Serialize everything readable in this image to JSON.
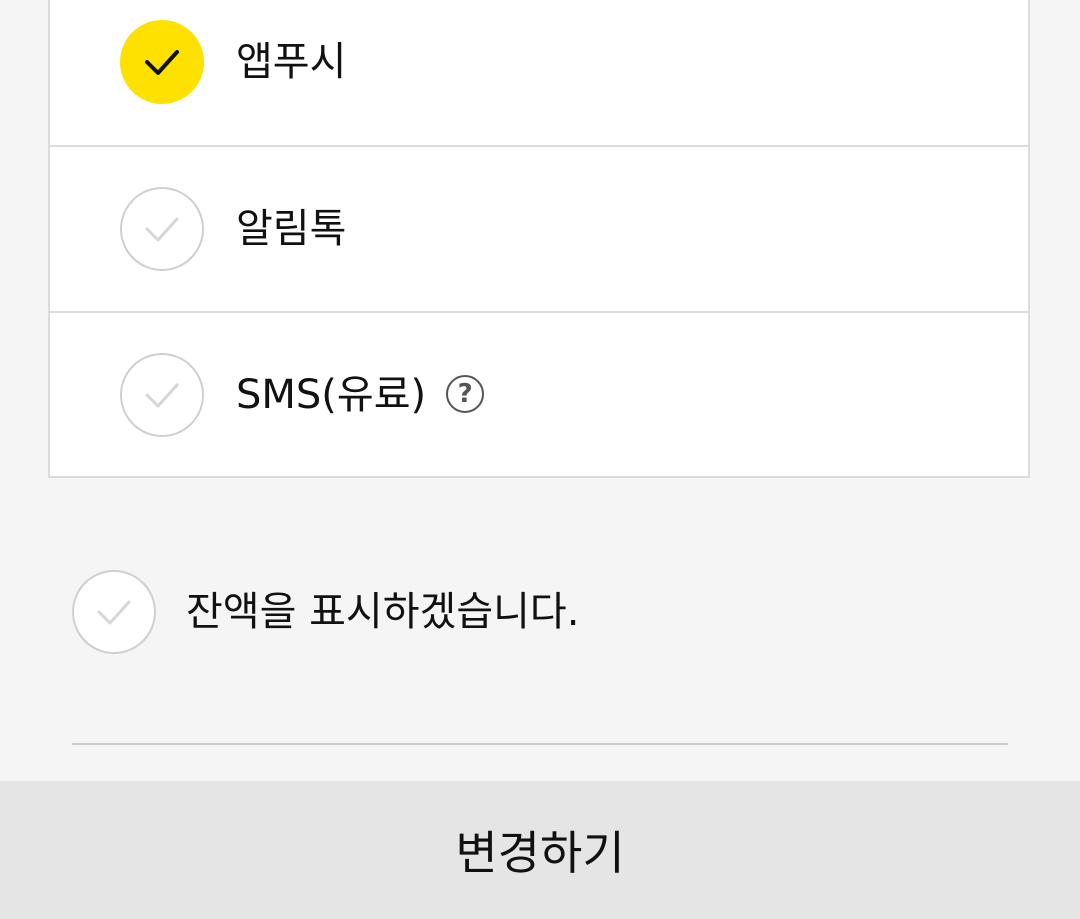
{
  "notification_options": [
    {
      "label": "앱푸시",
      "checked": true
    },
    {
      "label": "알림톡",
      "checked": false
    },
    {
      "label": "SMS(유료)",
      "checked": false,
      "help_icon": "?"
    }
  ],
  "balance_option": {
    "label": "잔액을 표시하겠습니다.",
    "checked": false
  },
  "submit": {
    "label": "변경하기"
  },
  "colors": {
    "checked_fill": "#ffe100",
    "unchecked_border": "#cfcfcf",
    "unchecked_check": "#d6d6d6",
    "checked_check": "#111111"
  }
}
